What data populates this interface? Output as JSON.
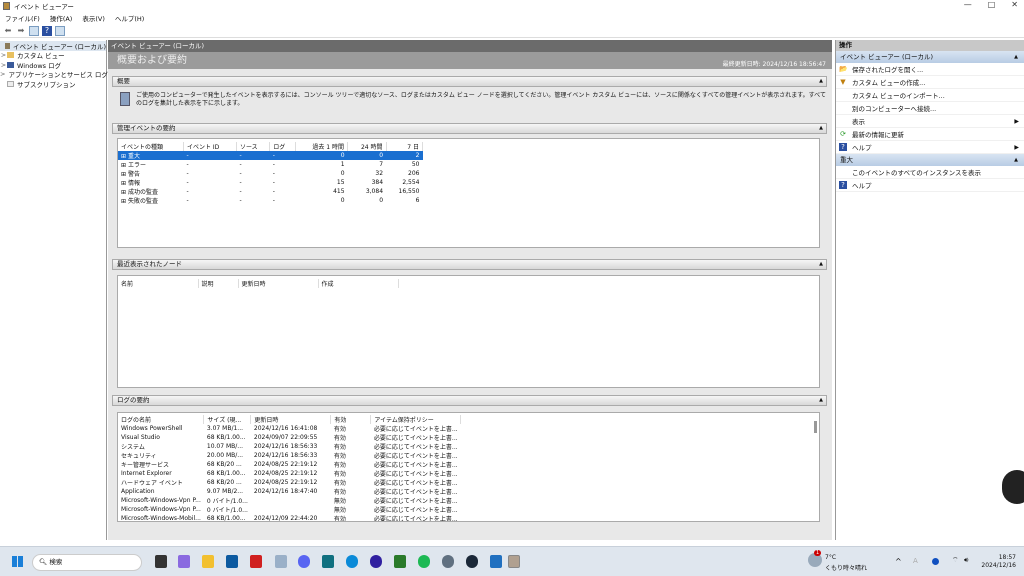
{
  "window": {
    "title": "イベント ビューアー",
    "controls": [
      "—",
      "□",
      "✕"
    ]
  },
  "menu": [
    "ファイル(F)",
    "操作(A)",
    "表示(V)",
    "ヘルプ(H)"
  ],
  "tree": [
    {
      "label": "イベント ビューアー (ローカル)",
      "chevron": ""
    },
    {
      "label": "カスタム ビュー",
      "chevron": ">"
    },
    {
      "label": "Windows ログ",
      "chevron": ">"
    },
    {
      "label": "アプリケーションとサービス ログ",
      "chevron": ">"
    },
    {
      "label": "サブスクリプション",
      "chevron": ""
    }
  ],
  "center": {
    "header": "イベント ビューアー (ローカル)",
    "title": "概要および要約",
    "last_updated": "最終更新日時: 2024/12/16 18:56:47",
    "overview": {
      "title": "概要",
      "text": "ご使用のコンピューターで発生したイベントを表示するには、コンソール ツリーで適切なソース、ログまたはカスタム ビュー ノードを選択してください。管理イベント カスタム ビューには、ソースに関係なくすべての管理イベントが表示されます。すべてのログを集計した表示を下に示します。"
    },
    "admin_events": {
      "title": "管理イベントの要約",
      "columns": [
        "イベントの種類",
        "イベント ID",
        "ソース",
        "ログ",
        "過去 1 時間",
        "24 時間",
        "7 日"
      ],
      "rows": [
        [
          "重大",
          "-",
          "-",
          "-",
          "0",
          "0",
          "2"
        ],
        [
          "エラー",
          "-",
          "-",
          "-",
          "1",
          "7",
          "50"
        ],
        [
          "警告",
          "-",
          "-",
          "-",
          "0",
          "32",
          "206"
        ],
        [
          "情報",
          "-",
          "-",
          "-",
          "15",
          "384",
          "2,554"
        ],
        [
          "成功の監査",
          "-",
          "-",
          "-",
          "415",
          "3,084",
          "16,550"
        ],
        [
          "失敗の監査",
          "-",
          "-",
          "-",
          "0",
          "0",
          "6"
        ]
      ]
    },
    "recent_nodes": {
      "title": "最近表示されたノード",
      "columns": [
        "名前",
        "説明",
        "更新日時",
        "作成"
      ]
    },
    "log_summary": {
      "title": "ログの要約",
      "columns": [
        "ログの名前",
        "サイズ (現...",
        "更新日時",
        "有効",
        "アイテム保持ポリシー"
      ],
      "rows": [
        [
          "Windows PowerShell",
          "3.07 MB/1...",
          "2024/12/16 16:41:08",
          "有効",
          "必要に応じてイベントを上書..."
        ],
        [
          "Visual Studio",
          "68 KB/1.00...",
          "2024/09/07 22:09:55",
          "有効",
          "必要に応じてイベントを上書..."
        ],
        [
          "システム",
          "10.07 MB/...",
          "2024/12/16 18:56:33",
          "有効",
          "必要に応じてイベントを上書..."
        ],
        [
          "セキュリティ",
          "20.00 MB/...",
          "2024/12/16 18:56:33",
          "有効",
          "必要に応じてイベントを上書..."
        ],
        [
          "キー管理サービス",
          "68 KB/20 ...",
          "2024/08/25 22:19:12",
          "有効",
          "必要に応じてイベントを上書..."
        ],
        [
          "Internet Explorer",
          "68 KB/1.00...",
          "2024/08/25 22:19:12",
          "有効",
          "必要に応じてイベントを上書..."
        ],
        [
          "ハードウェア イベント",
          "68 KB/20 ...",
          "2024/08/25 22:19:12",
          "有効",
          "必要に応じてイベントを上書..."
        ],
        [
          "Application",
          "9.07 MB/2...",
          "2024/12/16 18:47:40",
          "有効",
          "必要に応じてイベントを上書..."
        ],
        [
          "Microsoft-Windows-Vpn P...",
          "0 バイト/1.0...",
          "",
          "無効",
          "必要に応じてイベントを上書..."
        ],
        [
          "Microsoft-Windows-Vpn P...",
          "0 バイト/1.0...",
          "",
          "無効",
          "必要に応じてイベントを上書..."
        ],
        [
          "Microsoft-Windows-Mobil...",
          "68 KB/1.00...",
          "2024/12/09 22:44:20",
          "有効",
          "必要に応じてイベントを上書..."
        ]
      ]
    }
  },
  "actions": {
    "title": "操作",
    "section1": "イベント ビューアー (ローカル)",
    "items1": [
      {
        "label": "保存されたログを開く...",
        "icon": "📂",
        "sub": ""
      },
      {
        "label": "カスタム ビューの作成...",
        "icon": "▼",
        "sub": ""
      },
      {
        "label": "カスタム ビューのインポート...",
        "icon": "",
        "sub": ""
      },
      {
        "label": "別のコンピューターへ接続...",
        "icon": "",
        "sub": ""
      },
      {
        "label": "表示",
        "icon": "",
        "sub": "▶"
      },
      {
        "label": "最新の情報に更新",
        "icon": "⟳",
        "sub": ""
      },
      {
        "label": "ヘルプ",
        "icon": "?",
        "sub": "▶"
      }
    ],
    "section2": "重大",
    "items2": [
      {
        "label": "このイベントのすべてのインスタンスを表示",
        "icon": "",
        "sub": ""
      },
      {
        "label": "ヘルプ",
        "icon": "?",
        "sub": ""
      }
    ]
  },
  "taskbar": {
    "search": "検索",
    "weather_temp": "7°C",
    "weather_text": "くもり時々晴れ",
    "weather_badge": "1",
    "time": "18:57",
    "date": "2024/12/16"
  }
}
